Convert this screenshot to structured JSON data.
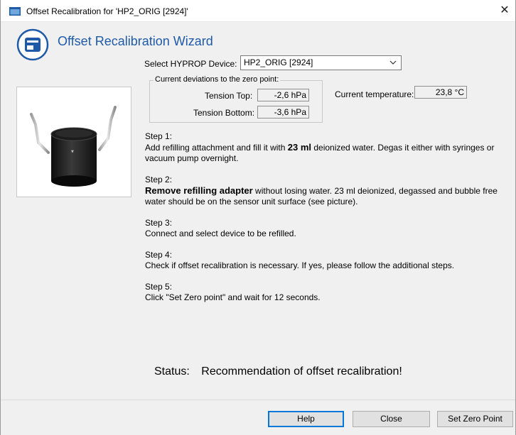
{
  "window": {
    "title": "Offset Recalibration for 'HP2_ORIG [2924]'",
    "close_glyph": "✕"
  },
  "wizard": {
    "title": "Offset Recalibration Wizard"
  },
  "device": {
    "label": "Select HYPROP Device:",
    "selected": "HP2_ORIG [2924]"
  },
  "deviations": {
    "legend": "Current deviations to the zero point:",
    "tension_top_label": "Tension Top:",
    "tension_top_value": "-2,6 hPa",
    "tension_bottom_label": "Tension Bottom:",
    "tension_bottom_value": "-3,6 hPa"
  },
  "temperature": {
    "label": "Current temperature:",
    "value": "23,8 °C"
  },
  "steps": [
    {
      "title": "Step 1:",
      "pre": "Add refilling attachment and fill it with ",
      "bold": "23 ml",
      "post": "  deionized water. Degas it either with syringes or vacuum pump overnight."
    },
    {
      "title": "Step 2:",
      "pre": "",
      "bold": "Remove refilling adapter",
      "post": " without losing water. 23 ml deionized, degassed and bubble free water should be on the sensor unit surface (see picture)."
    },
    {
      "title": "Step 3:",
      "text": "Connect and select device to be refilled."
    },
    {
      "title": "Step 4:",
      "text": "Check if offset recalibration is necessary. If yes, please follow the additional steps."
    },
    {
      "title": "Step 5:",
      "text": "Click \"Set Zero point\" and wait for 12 seconds."
    }
  ],
  "status": {
    "label": "Status:",
    "message": "Recommendation of offset recalibration!"
  },
  "buttons": {
    "help": "Help",
    "close": "Close",
    "set_zero": "Set Zero Point"
  },
  "colors": {
    "accent": "#1e5aa8",
    "default_button_border": "#0078d7"
  },
  "icons": {
    "app": "app-window-icon",
    "wizard": "wizard-device-icon",
    "dropdown": "chevron-down-icon",
    "close": "close-icon"
  }
}
